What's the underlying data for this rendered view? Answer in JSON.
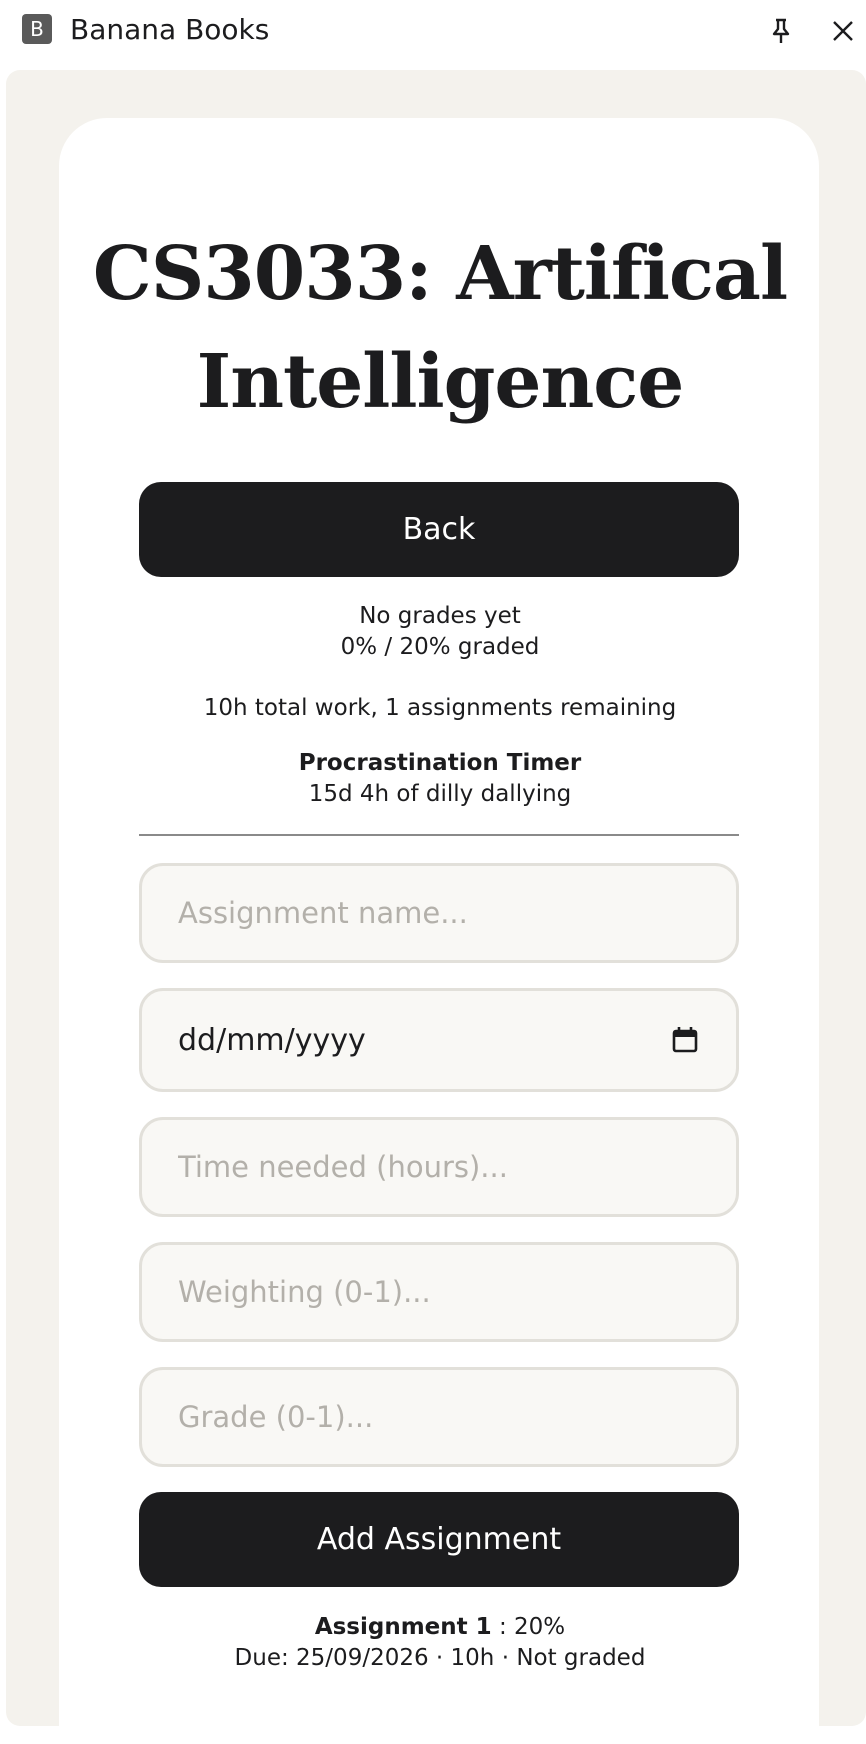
{
  "titlebar": {
    "app_logo_letter": "B",
    "app_title": "Banana Books"
  },
  "page": {
    "title": "CS3033: Artifical Intelligence",
    "back_label": "Back",
    "grades_status": "No grades yet",
    "graded_fraction": "0% / 20% graded",
    "work_summary": "10h total work, 1 assignments remaining",
    "timer_heading": "Procrastination Timer",
    "timer_value": "15d 4h of dilly dallying"
  },
  "form": {
    "name_placeholder": "Assignment name...",
    "date_placeholder": "dd/mm/yyyy",
    "time_placeholder": "Time needed (hours)...",
    "weighting_placeholder": "Weighting (0-1)...",
    "grade_placeholder": "Grade (0-1)...",
    "add_label": "Add Assignment"
  },
  "assignments": [
    {
      "name": "Assignment 1",
      "weight": " : 20%",
      "details": "Due: 25/09/2026 · 10h · Not graded"
    }
  ],
  "icons": {
    "pin": "pin-icon",
    "close": "close-icon",
    "calendar": "calendar-icon"
  },
  "colors": {
    "button": "#1c1c1e",
    "panel": "#f4f2ed",
    "field_bg": "#f9f8f5",
    "field_border": "#e2e0da"
  }
}
